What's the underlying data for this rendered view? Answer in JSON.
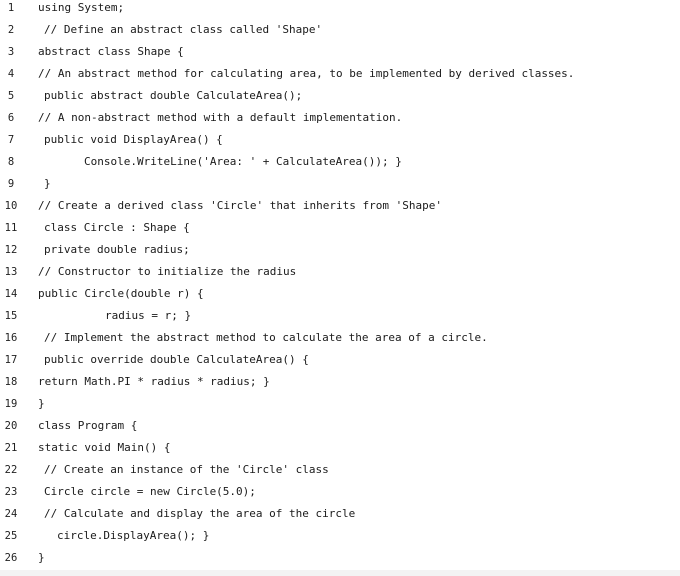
{
  "editor": {
    "lines": [
      {
        "num": "1",
        "text": "using System;",
        "indent": 0
      },
      {
        "num": "2",
        "text": "// Define an abstract class called 'Shape'",
        "indent": 1
      },
      {
        "num": "3",
        "text": "abstract class Shape {",
        "indent": 0
      },
      {
        "num": "4",
        "text": "// An abstract method for calculating area, to be implemented by derived classes.",
        "indent": 0
      },
      {
        "num": "5",
        "text": "public abstract double CalculateArea();",
        "indent": 1
      },
      {
        "num": "6",
        "text": "// A non-abstract method with a default implementation.",
        "indent": 0
      },
      {
        "num": "7",
        "text": "public void DisplayArea() {",
        "indent": 1
      },
      {
        "num": "8",
        "text": "Console.WriteLine('Area: ' + CalculateArea()); }",
        "indent": 2
      },
      {
        "num": "9",
        "text": "}",
        "indent": 1
      },
      {
        "num": "10",
        "text": "// Create a derived class 'Circle' that inherits from 'Shape'",
        "indent": 0
      },
      {
        "num": "11",
        "text": "class Circle : Shape {",
        "indent": 1
      },
      {
        "num": "12",
        "text": "private double radius;",
        "indent": 1
      },
      {
        "num": "13",
        "text": "// Constructor to initialize the radius",
        "indent": 0
      },
      {
        "num": "14",
        "text": "public Circle(double r) {",
        "indent": 0
      },
      {
        "num": "15",
        "text": "radius = r; }",
        "indent": 3
      },
      {
        "num": "16",
        "text": "// Implement the abstract method to calculate the area of a circle.",
        "indent": 1
      },
      {
        "num": "17",
        "text": "public override double CalculateArea() {",
        "indent": 1
      },
      {
        "num": "18",
        "text": "return Math.PI * radius * radius; }",
        "indent": 0
      },
      {
        "num": "19",
        "text": "}",
        "indent": 0
      },
      {
        "num": "20",
        "text": "class Program {",
        "indent": 0
      },
      {
        "num": "21",
        "text": "static void Main() {",
        "indent": 0
      },
      {
        "num": "22",
        "text": "// Create an instance of the 'Circle' class",
        "indent": 1
      },
      {
        "num": "23",
        "text": "Circle circle = new Circle(5.0);",
        "indent": 1
      },
      {
        "num": "24",
        "text": "// Calculate and display the area of the circle",
        "indent": 1
      },
      {
        "num": "25",
        "text": "circle.DisplayArea(); }",
        "indent": 4
      },
      {
        "num": "26",
        "text": "}",
        "indent": 0
      }
    ]
  }
}
